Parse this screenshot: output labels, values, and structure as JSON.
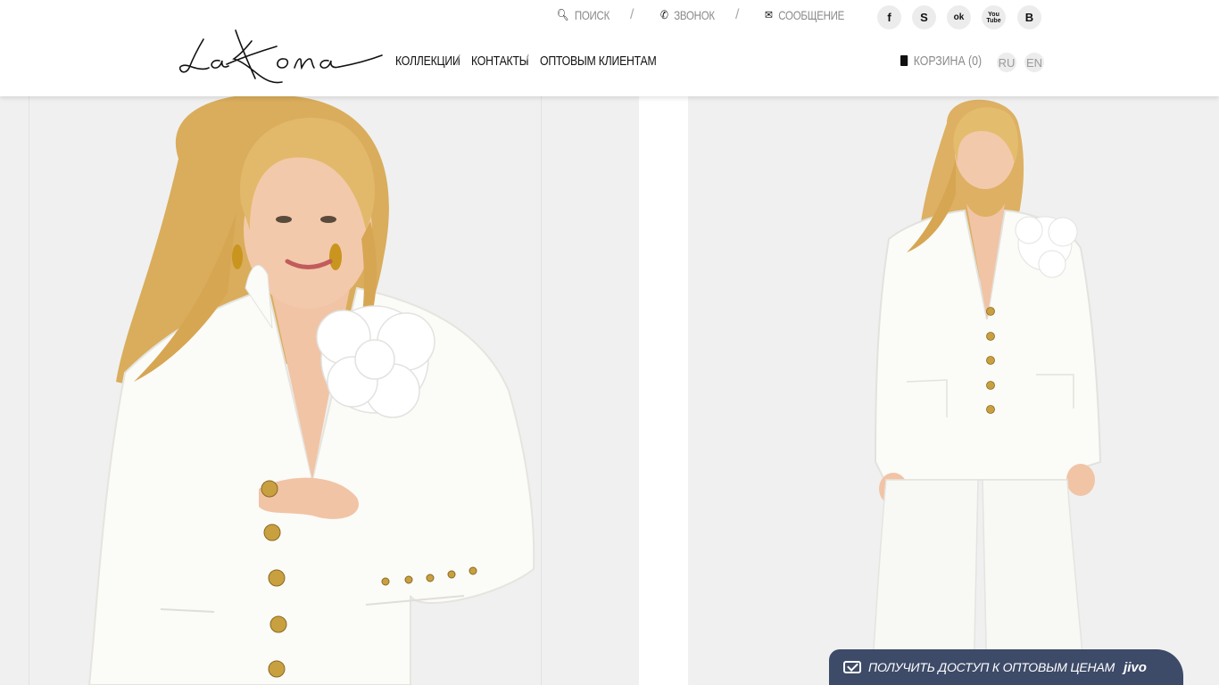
{
  "topbar": {
    "search_label": "ПОИСК",
    "call_label": "ЗВОНОК",
    "message_label": "СООБЩЕНИЕ",
    "separator": "/"
  },
  "social": {
    "facebook": "f",
    "skype": "S",
    "odnoklassniki": "ok",
    "youtube": "You\nTube",
    "vk": "B"
  },
  "logo": {
    "text": "LaKona"
  },
  "nav": {
    "items": [
      {
        "label": "КОЛЛЕКЦИИ"
      },
      {
        "label": "КОНТАКТЫ"
      },
      {
        "label": "ОПТОВЫМ КЛИЕНТАМ"
      }
    ],
    "separator": "/"
  },
  "cart": {
    "label": "КОРЗИНА (0)"
  },
  "languages": [
    "RU",
    "EN"
  ],
  "jivo": {
    "cta_label": "ПОЛУЧИТЬ ДОСТУП К ОПТОВЫМ ЦЕНАМ",
    "brand": "jivo"
  },
  "colors": {
    "panel_bg": "#f0f0f0",
    "jivo_bg": "#3d4a68",
    "muted_text": "#8a8a8a"
  }
}
